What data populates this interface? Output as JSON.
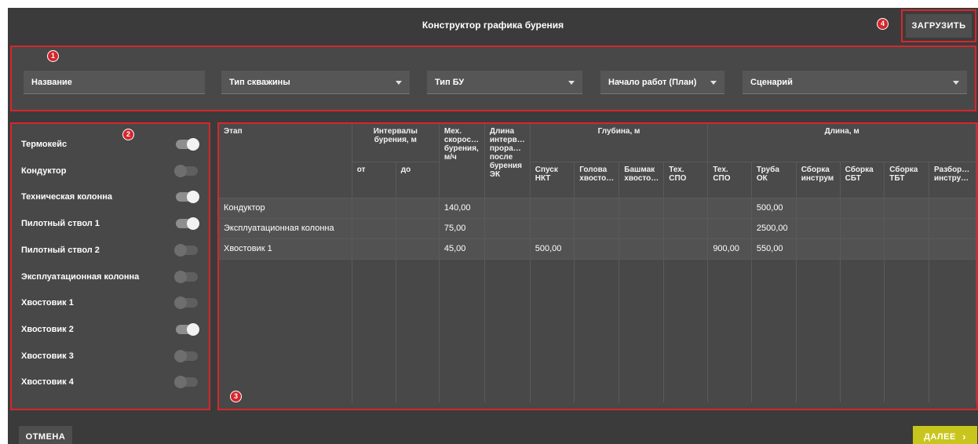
{
  "header": {
    "title": "Конструктор графика бурения",
    "load_label": "ЗАГРУЗИТЬ"
  },
  "badges": [
    "1",
    "2",
    "3",
    "4"
  ],
  "filters": {
    "name": "Название",
    "well_type": "Тип скважины",
    "rig_type": "Тип БУ",
    "start_date": "Начало работ (План)",
    "scenario": "Сценарий"
  },
  "stages": [
    {
      "label": "Термокейс",
      "on": true
    },
    {
      "label": "Кондуктор",
      "on": false
    },
    {
      "label": "Техническая колонна",
      "on": true
    },
    {
      "label": "Пилотный ствол 1",
      "on": true
    },
    {
      "label": "Пилотный ствол 2",
      "on": false
    },
    {
      "label": "Эксплуатационная колонна",
      "on": false
    },
    {
      "label": "Хвостовик 1",
      "on": false
    },
    {
      "label": "Хвостовик 2",
      "on": true
    },
    {
      "label": "Хвостовик 3",
      "on": false
    },
    {
      "label": "Хвостовик 4",
      "on": false
    }
  ],
  "table": {
    "col_stage": "Этап",
    "col_intervals": "Интервалы бурения, м",
    "col_from": "от",
    "col_to": "до",
    "col_speed": "Мех. скорос… бурения, м/ч",
    "col_interval_len": "Длина интерв… прора… после бурения ЭК",
    "group_depth": "Глубина, м",
    "group_length": "Длина, м",
    "depth_cols": [
      "Спуск НКТ",
      "Голова хвосто…",
      "Башмак хвосто…",
      "Тех. СПО"
    ],
    "length_cols": [
      "Тех. СПО",
      "Труба ОК",
      "Сборка инструм",
      "Сборка СБТ",
      "Сборка ТБТ",
      "Разбор… инстру…"
    ],
    "rows": [
      [
        "Кондуктор",
        "",
        "",
        "140,00",
        "",
        "",
        "",
        "",
        "",
        "",
        "500,00",
        "",
        "",
        "",
        ""
      ],
      [
        "Эксплуатационная колонна",
        "",
        "",
        "75,00",
        "",
        "",
        "",
        "",
        "",
        "",
        "2500,00",
        "",
        "",
        "",
        ""
      ],
      [
        "Хвостовик 1",
        "",
        "",
        "45,00",
        "",
        "500,00",
        "",
        "",
        "",
        "900,00",
        "550,00",
        "",
        "",
        "",
        ""
      ]
    ]
  },
  "footer": {
    "cancel_label": "ОТМЕНА",
    "next_label": "ДАЛЕЕ",
    "next_icon": "chevron-right-icon"
  },
  "colors": {
    "background": "#3b3b3b",
    "panel": "#484848",
    "accent": "#c8c51d",
    "highlight": "#d7262d"
  }
}
